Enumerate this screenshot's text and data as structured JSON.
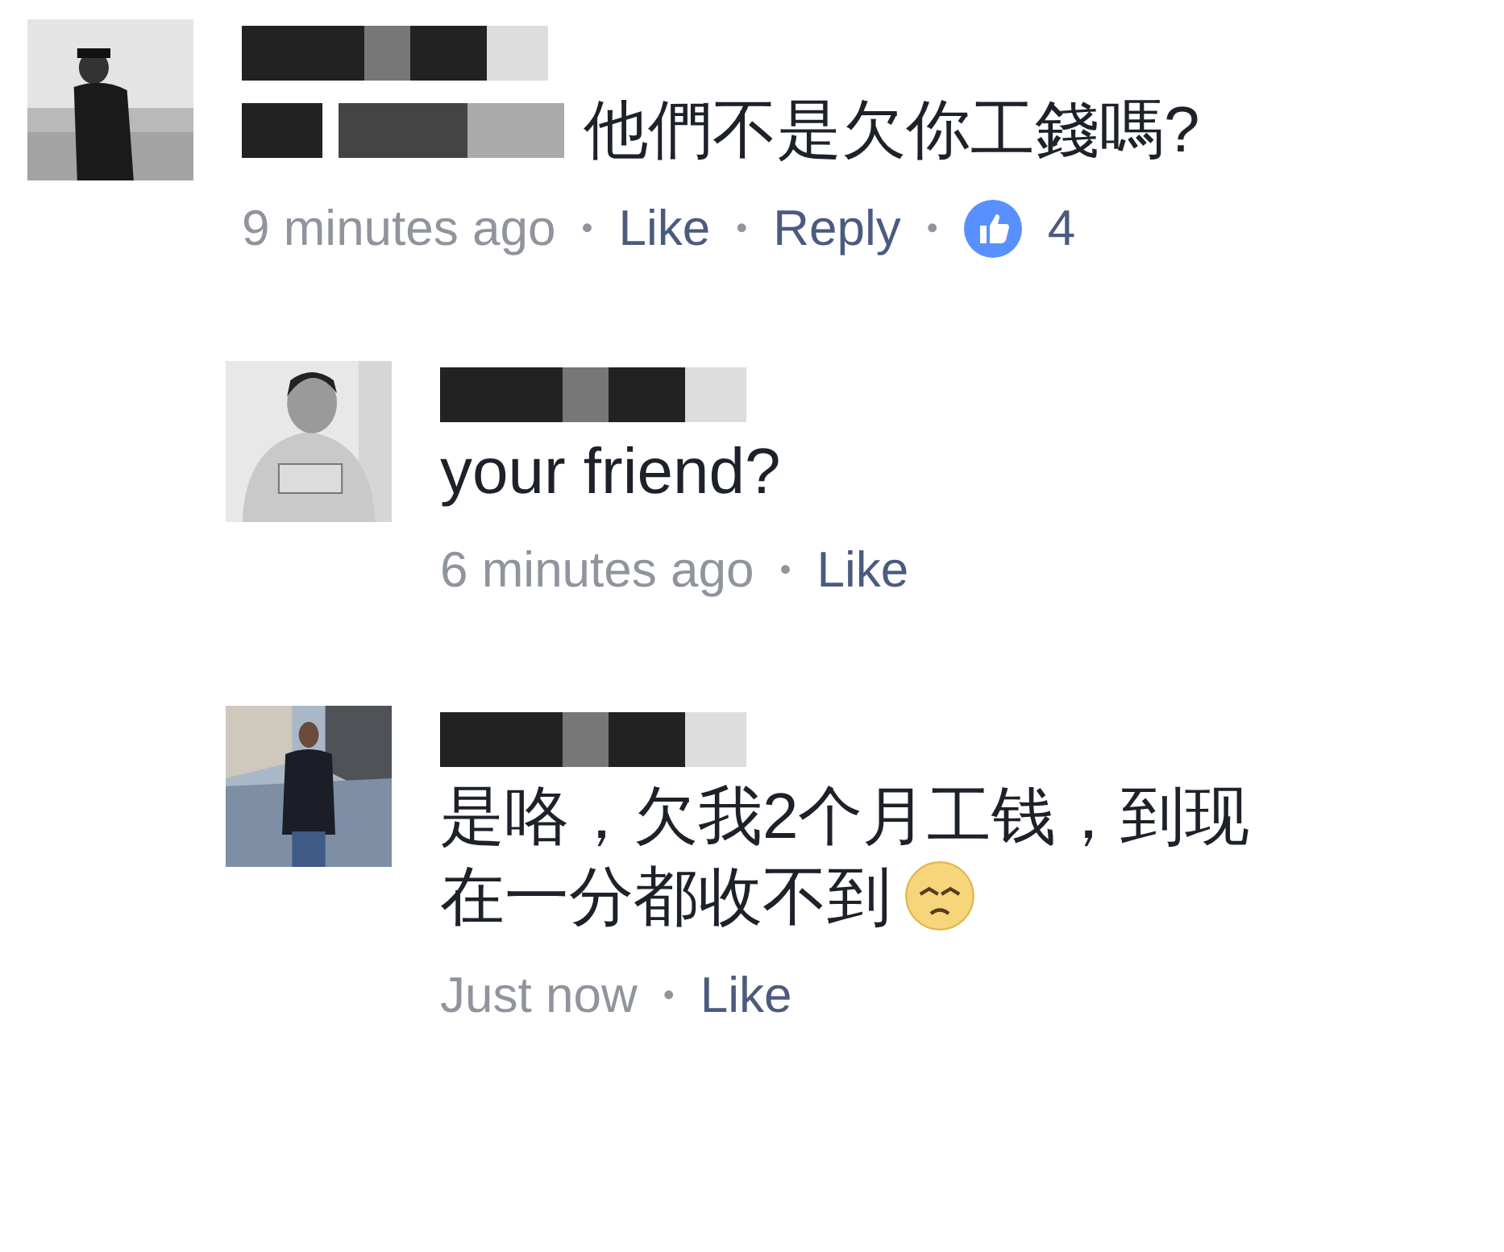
{
  "separator": "•",
  "comments": [
    {
      "name_redacted": true,
      "mention_redacted": true,
      "text": "他們不是欠你工錢嗎?",
      "time": "9 minutes ago",
      "actions": [
        "Like",
        "Reply"
      ],
      "like_count": "4",
      "children": [
        {
          "name_redacted": true,
          "mention_redacted": false,
          "text": "your friend?",
          "time": "6 minutes ago",
          "actions": [
            "Like"
          ]
        },
        {
          "name_redacted": true,
          "mention_redacted": false,
          "text": "是咯，欠我2个月工钱，到现在一分都收不到",
          "trailing_icon": {
            "kind": "sad_face"
          },
          "time": "Just now",
          "actions": [
            "Like"
          ]
        }
      ]
    }
  ]
}
